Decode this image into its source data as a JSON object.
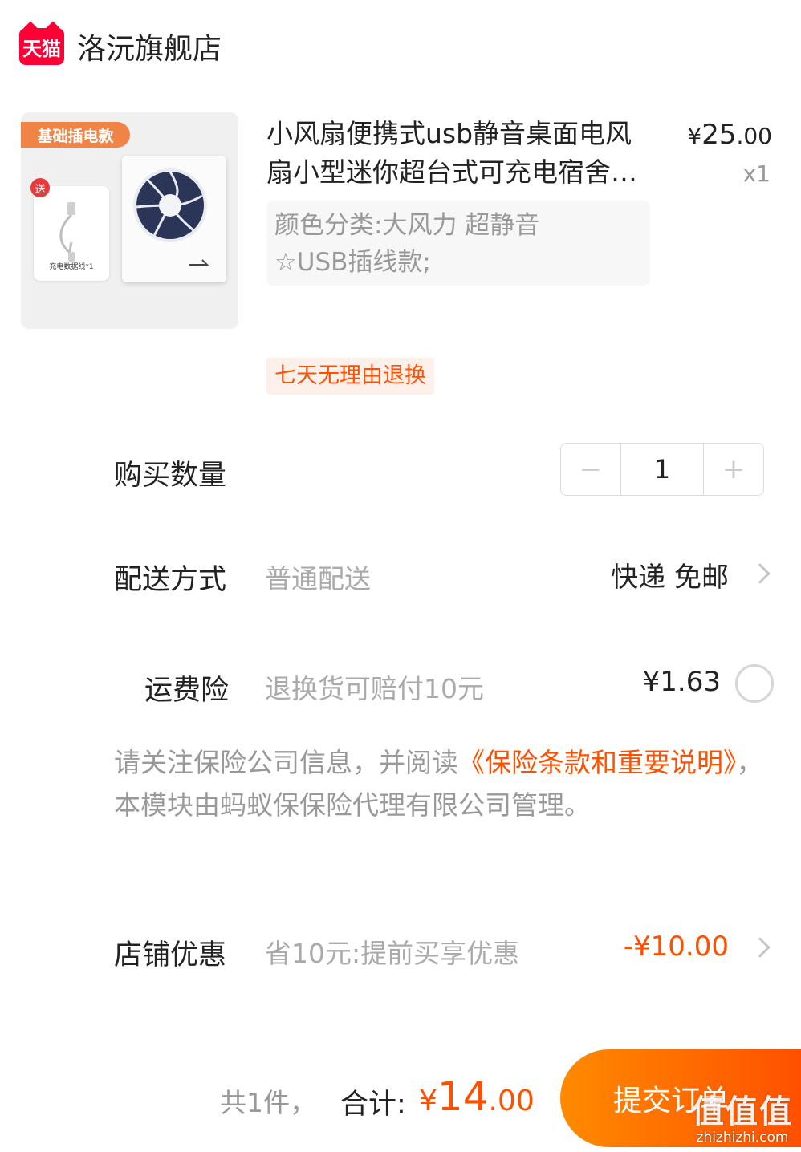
{
  "store": {
    "badge": "天猫",
    "name": "洛沅旗舰店"
  },
  "product": {
    "image_tag": "基础插电款",
    "image_gift": "送",
    "image_cable_label": "充电数据线*1",
    "title": "小风扇便携式usb静音桌面电风扇小型迷你超台式可充电宿舍学生",
    "price_currency": "¥",
    "price_int": "25",
    "price_dec": ".00",
    "quantity": "x1",
    "sku_line1": "颜色分类:大风力 超静音",
    "sku_line2": "☆USB插线款;",
    "return_tag": "七天无理由退换"
  },
  "purchase_qty": {
    "label": "购买数量",
    "minus": "−",
    "value": "1",
    "plus": "+"
  },
  "delivery": {
    "label": "配送方式",
    "desc": "普通配送",
    "value": "快递 免邮"
  },
  "insurance": {
    "label": "运费险",
    "desc": "退换货可赔付10元",
    "price": "¥1.63"
  },
  "notice": {
    "prefix": "请关注保险公司信息，并阅读",
    "link": "《保险条款和重要说明》",
    "suffix": "，本模块由蚂蚁保保险代理有限公司管理。"
  },
  "discount": {
    "label": "店铺优惠",
    "desc": "省10元:提前买享优惠",
    "value": "-¥10.00"
  },
  "footer": {
    "count": "共1件，",
    "total_label": "合计:",
    "total_currency": "¥",
    "total_int": "14",
    "total_dec": ".00",
    "submit": "提交订单"
  },
  "watermark": {
    "logo": "值值值",
    "url": "zhizhizhi.com"
  }
}
